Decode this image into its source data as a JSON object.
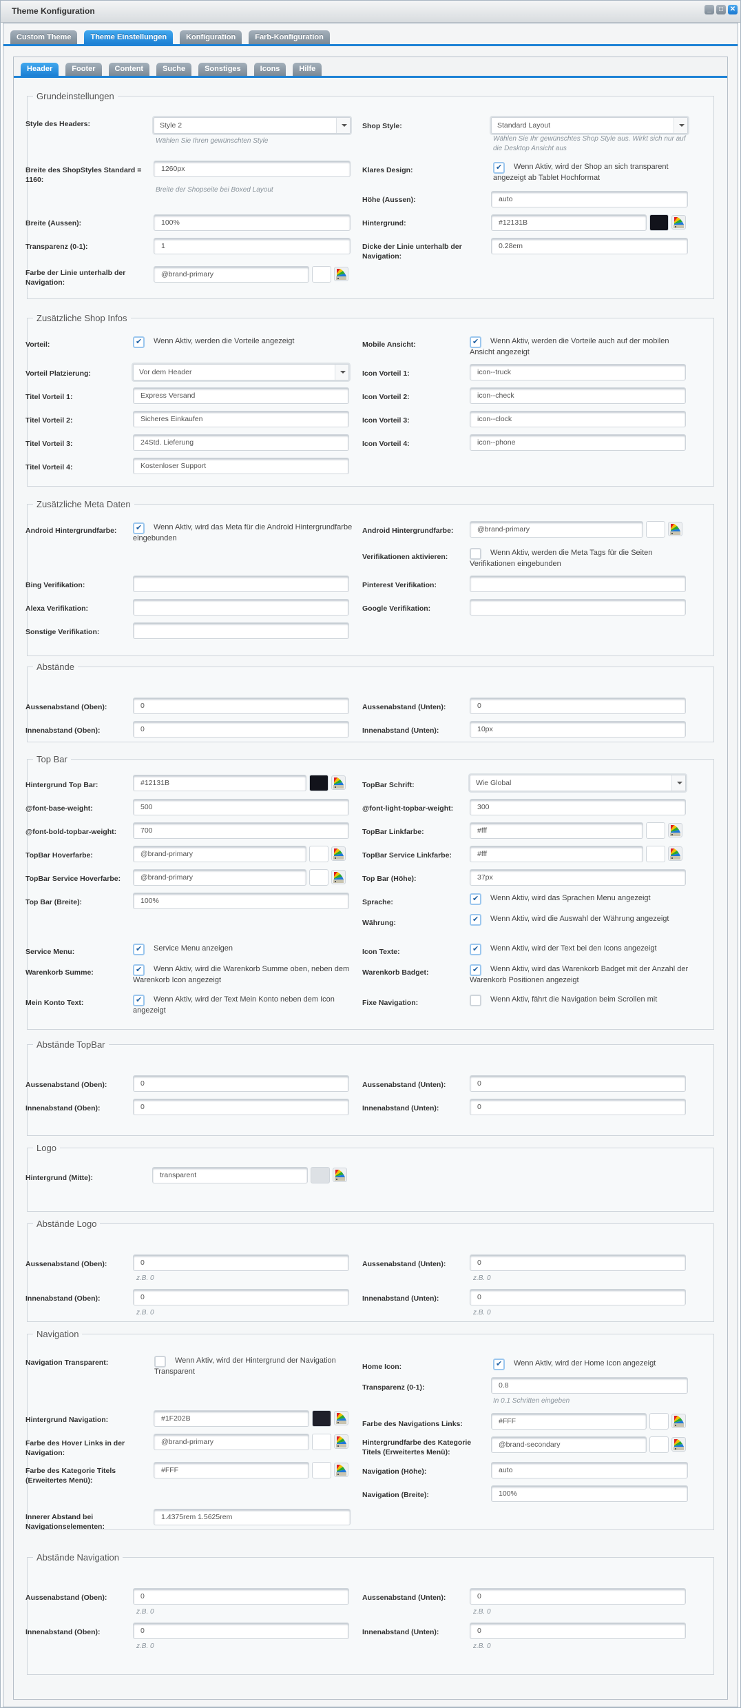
{
  "window": {
    "title": "Theme Konfiguration",
    "controls": [
      "minimize-icon",
      "maximize-icon",
      "close-icon"
    ]
  },
  "main_tabs": [
    {
      "label": "Custom Theme",
      "active": false
    },
    {
      "label": "Theme Einstellungen",
      "active": true
    },
    {
      "label": "Konfiguration",
      "active": false
    },
    {
      "label": "Farb-Konfiguration",
      "active": false
    }
  ],
  "sub_tabs": [
    {
      "label": "Header",
      "active": true
    },
    {
      "label": "Footer",
      "active": false
    },
    {
      "label": "Content",
      "active": false
    },
    {
      "label": "Suche",
      "active": false
    },
    {
      "label": "Sonstiges",
      "active": false
    },
    {
      "label": "Icons",
      "active": false
    },
    {
      "label": "Hilfe",
      "active": false
    }
  ],
  "colors": {
    "accent": "#1e82d6",
    "dark_bg": "#12131B",
    "nav_bg": "#1F202B"
  },
  "sections": {
    "grund": {
      "legend": "Grundeinstellungen",
      "style_headers": {
        "label": "Style des Headers:",
        "value": "Style 2",
        "hint": "Wählen Sie Ihren gewünschten Style"
      },
      "breite_shop": {
        "label": "Breite des ShopStyles Standard = 1160:",
        "value": "1260px",
        "hint": "Breite der Shopseite bei Boxed Layout"
      },
      "breite_aussen": {
        "label": "Breite (Aussen):",
        "value": "100%"
      },
      "transparenz": {
        "label": "Transparenz (0-1):",
        "value": "1"
      },
      "farbe_linie": {
        "label": "Farbe der Linie unterhalb der Navigation:",
        "value": "@brand-primary"
      },
      "shop_style": {
        "label": "Shop Style:",
        "value": "Standard Layout",
        "hint": "Wählen Sie Ihr gewünschtes Shop Style aus. Wirkt sich nur auf die Desktop Ansicht aus"
      },
      "klares_design": {
        "label": "Klares Design:",
        "checked": true,
        "text": "Wenn Aktiv, wird der Shop an sich transparent angezeigt ab Tablet Hochformat"
      },
      "hoehe_aussen": {
        "label": "Höhe (Aussen):",
        "value": "auto"
      },
      "hintergrund": {
        "label": "Hintergrund:",
        "value": "#12131B"
      },
      "dicke_linie": {
        "label": "Dicke der Linie unterhalb der Navigation:",
        "value": "0.28em"
      }
    },
    "shopinfos": {
      "legend": "Zusätzliche Shop Infos",
      "vorteil": {
        "label": "Vorteil:",
        "checked": true,
        "text": "Wenn Aktiv, werden die Vorteile angezeigt"
      },
      "platzierung": {
        "label": "Vorteil Platzierung:",
        "value": "Vor dem Header"
      },
      "titel1": {
        "label": "Titel Vorteil 1:",
        "value": "Express Versand"
      },
      "titel2": {
        "label": "Titel Vorteil 2:",
        "value": "Sicheres Einkaufen"
      },
      "titel3": {
        "label": "Titel Vorteil 3:",
        "value": "24Std. Lieferung"
      },
      "titel4": {
        "label": "Titel Vorteil 4:",
        "value": "Kostenloser Support"
      },
      "mobile": {
        "label": "Mobile Ansicht:",
        "checked": true,
        "text": "Wenn Aktiv, werden die Vorteile auch auf der mobilen Ansicht angezeigt"
      },
      "icon1": {
        "label": "Icon Vorteil 1:",
        "value": "icon--truck"
      },
      "icon2": {
        "label": "Icon Vorteil 2:",
        "value": "icon--check"
      },
      "icon3": {
        "label": "Icon Vorteil 3:",
        "value": "icon--clock"
      },
      "icon4": {
        "label": "Icon Vorteil 4:",
        "value": "icon--phone"
      }
    },
    "meta": {
      "legend": "Zusätzliche Meta Daten",
      "android_cb": {
        "label": "Android Hintergrundfarbe:",
        "checked": true,
        "text": "Wenn Aktiv, wird das Meta für die Android Hintergrundfarbe eingebunden"
      },
      "android_color": {
        "label": "Android Hintergrundfarbe:",
        "value": "@brand-primary"
      },
      "verif": {
        "label": "Verifikationen aktivieren:",
        "checked": false,
        "text": "Wenn Aktiv, werden die Meta Tags für die Seiten Verifikationen eingebunden"
      },
      "bing": {
        "label": "Bing Verifikation:",
        "value": ""
      },
      "alexa": {
        "label": "Alexa Verifikation:",
        "value": ""
      },
      "sonstige": {
        "label": "Sonstige Verifikation:",
        "value": ""
      },
      "pinterest": {
        "label": "Pinterest Verifikation:",
        "value": ""
      },
      "google": {
        "label": "Google Verifikation:",
        "value": ""
      }
    },
    "abstaende": {
      "legend": "Abstände",
      "ao": {
        "label": "Aussenabstand (Oben):",
        "value": "0"
      },
      "au": {
        "label": "Aussenabstand (Unten):",
        "value": "0"
      },
      "io": {
        "label": "Innenabstand (Oben):",
        "value": "0"
      },
      "iu": {
        "label": "Innenabstand (Unten):",
        "value": "10px"
      }
    },
    "topbar": {
      "legend": "Top Bar",
      "bg": {
        "label": "Hintergrund Top Bar:",
        "value": "#12131B"
      },
      "base_w": {
        "label": "@font-base-weight:",
        "value": "500"
      },
      "bold_w": {
        "label": "@font-bold-topbar-weight:",
        "value": "700"
      },
      "hover": {
        "label": "TopBar Hoverfarbe:",
        "value": "@brand-primary"
      },
      "service_hover": {
        "label": "TopBar Service Hoverfarbe:",
        "value": "@brand-primary"
      },
      "breite": {
        "label": "Top Bar (Breite):",
        "value": "100%"
      },
      "service_menu": {
        "label": "Service Menu:",
        "checked": true,
        "text": "Service Menu anzeigen"
      },
      "wk_summe": {
        "label": "Warenkorb Summe:",
        "checked": true,
        "text": "Wenn Aktiv, wird die Warenkorb Summe oben, neben dem Warenkorb Icon angezeigt"
      },
      "konto": {
        "label": "Mein Konto Text:",
        "checked": true,
        "text": "Wenn Aktiv, wird der Text Mein Konto neben dem Icon angezeigt"
      },
      "schrift": {
        "label": "TopBar Schrift:",
        "value": "Wie Global"
      },
      "light_w": {
        "label": "@font-light-topbar-weight:",
        "value": "300"
      },
      "link": {
        "label": "TopBar Linkfarbe:",
        "value": "#fff"
      },
      "service_link": {
        "label": "TopBar Service Linkfarbe:",
        "value": "#fff"
      },
      "hoehe": {
        "label": "Top Bar (Höhe):",
        "value": "37px"
      },
      "sprache": {
        "label": "Sprache:",
        "checked": true,
        "text": "Wenn Aktiv, wird das Sprachen Menu angezeigt"
      },
      "waehrung": {
        "label": "Währung:",
        "checked": true,
        "text": "Wenn Aktiv, wird die Auswahl der Währung angezeigt"
      },
      "icon_texte": {
        "label": "Icon Texte:",
        "checked": true,
        "text": "Wenn Aktiv, wird der Text bei den Icons angezeigt"
      },
      "badget": {
        "label": "Warenkorb Badget:",
        "checked": true,
        "text": "Wenn Aktiv, wird das Warenkorb Badget mit der Anzahl der Warenkorb Positionen angezeigt"
      },
      "fixe_nav": {
        "label": "Fixe Navigation:",
        "checked": false,
        "text": "Wenn Aktiv, fährt die Navigation beim Scrollen mit"
      }
    },
    "abst_topbar": {
      "legend": "Abstände TopBar",
      "ao": {
        "label": "Aussenabstand (Oben):",
        "value": "0"
      },
      "au": {
        "label": "Aussenabstand (Unten):",
        "value": "0"
      },
      "io": {
        "label": "Innenabstand (Oben):",
        "value": "0"
      },
      "iu": {
        "label": "Innenabstand (Unten):",
        "value": "0"
      }
    },
    "logo": {
      "legend": "Logo",
      "bg": {
        "label": "Hintergrund (Mitte):",
        "value": "transparent"
      }
    },
    "abst_logo": {
      "legend": "Abstände Logo",
      "hint": "z.B. 0",
      "ao": {
        "label": "Aussenabstand (Oben):",
        "value": "0"
      },
      "au": {
        "label": "Aussenabstand (Unten):",
        "value": "0"
      },
      "io": {
        "label": "Innenabstand (Oben):",
        "value": "0"
      },
      "iu": {
        "label": "Innenabstand (Unten):",
        "value": "0"
      }
    },
    "nav": {
      "legend": "Navigation",
      "transp_cb": {
        "label": "Navigation Transparent:",
        "checked": false,
        "text": "Wenn Aktiv, wird der Hintergrund der Navigation Transparent"
      },
      "bg": {
        "label": "Hintergrund Navigation:",
        "value": "#1F202B"
      },
      "hover": {
        "label": "Farbe des Hover Links in der Navigation:",
        "value": "@brand-primary"
      },
      "kat_farbe": {
        "label": "Farbe des Kategorie Titels (Erweitertes Menü):",
        "value": "#FFF"
      },
      "innerer": {
        "label": "Innerer Abstand bei Navigationselementen:",
        "value": "1.4375rem 1.5625rem"
      },
      "home": {
        "label": "Home Icon:",
        "checked": true,
        "text": "Wenn Aktiv, wird der Home Icon angezeigt"
      },
      "transparenz": {
        "label": "Transparenz (0-1):",
        "value": "0.8",
        "hint": "In 0.1 Schritten eingeben"
      },
      "links": {
        "label": "Farbe des Navigations Links:",
        "value": "#FFF"
      },
      "kat_bg": {
        "label": "Hintergrundfarbe des Kategorie Titels (Erweitertes Menü):",
        "value": "@brand-secondary"
      },
      "hoehe": {
        "label": "Navigation (Höhe):",
        "value": "auto"
      },
      "breite": {
        "label": "Navigation (Breite):",
        "value": "100%"
      }
    },
    "abst_nav": {
      "legend": "Abstände Navigation",
      "hint": "z.B. 0",
      "ao": {
        "label": "Aussenabstand (Oben):",
        "value": "0"
      },
      "au": {
        "label": "Aussenabstand (Unten):",
        "value": "0"
      },
      "io": {
        "label": "Innenabstand (Oben):",
        "value": "0"
      },
      "iu": {
        "label": "Innenabstand (Unten):",
        "value": "0"
      }
    }
  }
}
